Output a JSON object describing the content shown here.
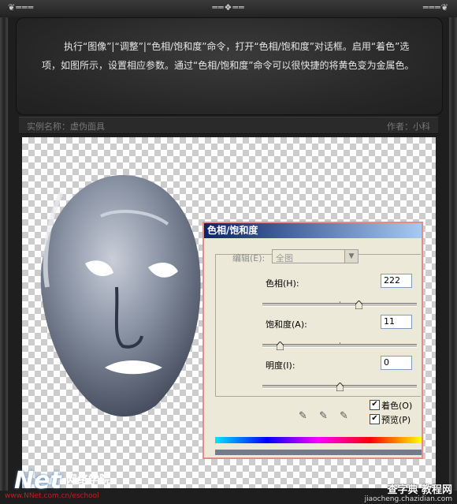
{
  "tutorial": {
    "text": "执行“图像”|“调整”|“色相/饱和度”命令，打开“色相/饱和度”对话框。启用“着色”选项，如图所示，设置相应参数。通过“色相/饱和度”命令可以很快捷的将黄色变为金属色。",
    "example_label": "实例名称：虚伪面具",
    "author_label": "作者：小科"
  },
  "dialog": {
    "title": "色相/饱和度",
    "edit_label": "编辑(E):",
    "edit_value": "全图",
    "hue_label": "色相(H):",
    "hue_value": "222",
    "hue_fraction": 0.62,
    "saturation_label": "饱和度(A):",
    "saturation_value": "11",
    "saturation_fraction": 0.11,
    "lightness_label": "明度(I):",
    "lightness_value": "0",
    "lightness_fraction": 0.5,
    "colorize_label": "着色(O)",
    "colorize_checked": true,
    "preview_label": "预览(P)",
    "preview_checked": true,
    "icons": [
      "eyedropper-icon",
      "eyedropper-plus-icon",
      "eyedropper-minus-icon"
    ]
  },
  "watermark": {
    "left_brand": "Net",
    "left_cn": "网络学院",
    "left_url": "www.NNet.com.cn/eschool",
    "right_brand": "查字典 教程网",
    "right_url": "jiaocheng.chazidian.com"
  },
  "colors": {
    "title_start": "#0a246a",
    "title_end": "#a6caf0",
    "dialog_bg": "#ece9d8",
    "mask_tone": "#6f7a8d"
  }
}
